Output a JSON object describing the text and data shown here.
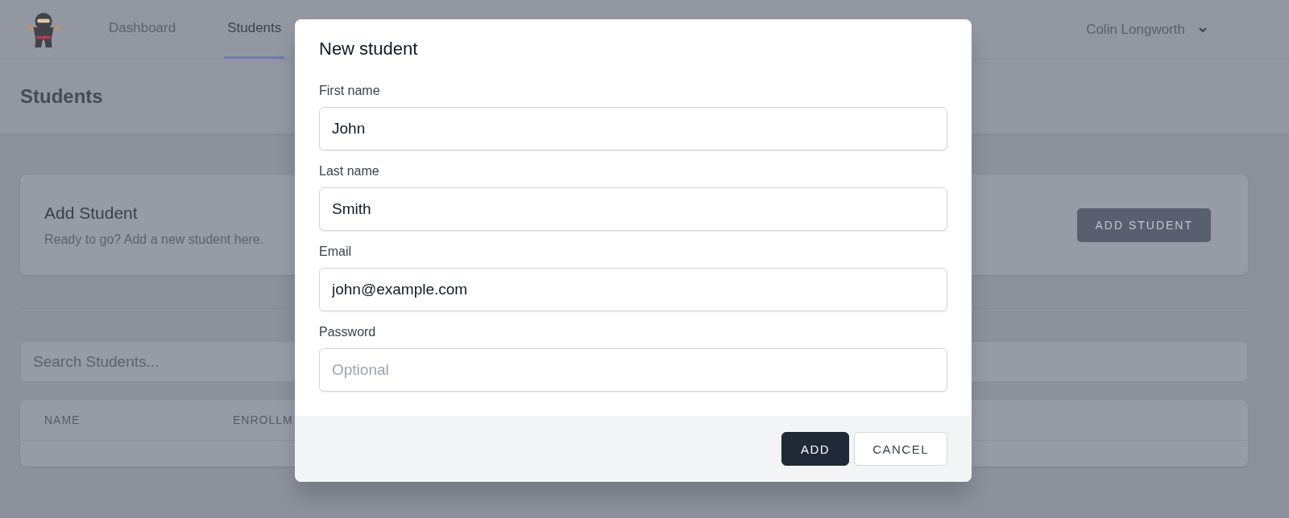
{
  "header": {
    "nav": [
      {
        "label": "Dashboard",
        "selected": false
      },
      {
        "label": "Students",
        "selected": true
      }
    ],
    "user_menu": {
      "name": "Colin Longworth"
    }
  },
  "page_title": "Students",
  "add_card": {
    "title": "Add Student",
    "description": "Ready to go? Add a new student here.",
    "button": "ADD STUDENT"
  },
  "search": {
    "placeholder": "Search Students..."
  },
  "table": {
    "columns": [
      "NAME",
      "ENROLLM"
    ]
  },
  "modal": {
    "title": "New student",
    "fields": [
      {
        "label": "First name",
        "value": "John"
      },
      {
        "label": "Last name",
        "value": "Smith"
      },
      {
        "label": "Email",
        "value": "john@example.com"
      },
      {
        "label": "Password",
        "placeholder": "Optional"
      }
    ],
    "buttons": [
      {
        "label": "ADD",
        "kind": "primary"
      },
      {
        "label": "CANCEL",
        "kind": "secondary"
      }
    ]
  }
}
